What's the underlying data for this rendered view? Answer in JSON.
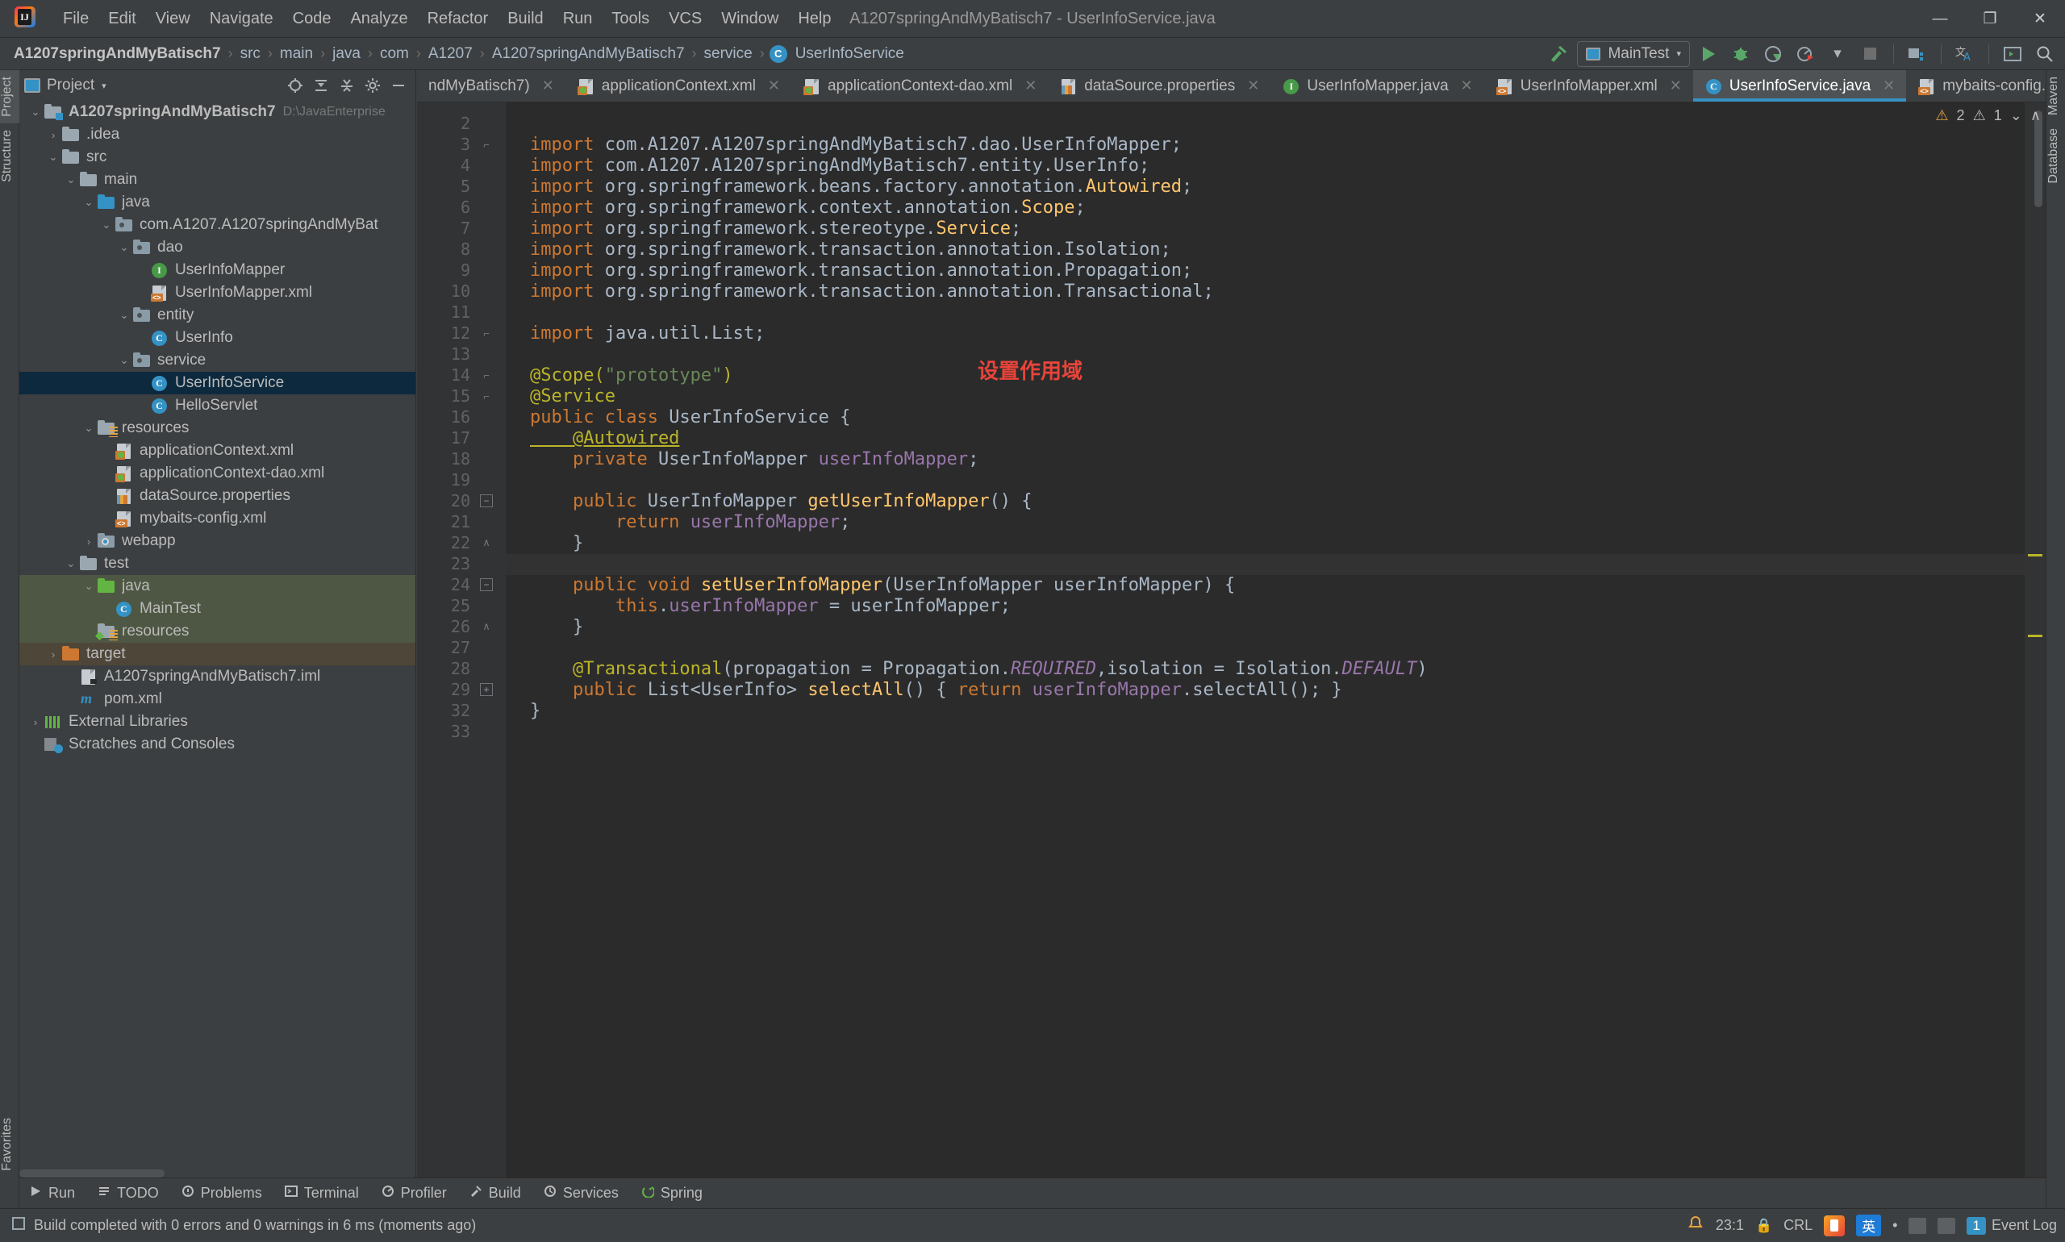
{
  "window": {
    "title": "A1207springAndMyBatisch7 - UserInfoService.java",
    "minimize": "—",
    "maximize": "❐",
    "close": "✕"
  },
  "menubar": {
    "items": [
      "File",
      "Edit",
      "View",
      "Navigate",
      "Code",
      "Analyze",
      "Refactor",
      "Build",
      "Run",
      "Tools",
      "VCS",
      "Window",
      "Help"
    ]
  },
  "breadcrumb": {
    "items": [
      "A1207springAndMyBatisch7",
      "src",
      "main",
      "java",
      "com",
      "A1207",
      "A1207springAndMyBatisch7",
      "service",
      "UserInfoService"
    ],
    "class_icon_letter": "C",
    "separator": "›"
  },
  "toolbar": {
    "run_config": "MainTest",
    "run_label": "Run",
    "debug_label": "Debug",
    "run_coverage_label": "Run with Coverage",
    "profiler_label": "Profile",
    "stop_label": "Stop",
    "build_label": "Build Project",
    "translate_label": "Translate",
    "terminal_label": "Terminal",
    "search_label": "Search Everywhere",
    "updates_label": "Update Project",
    "caret": "▾"
  },
  "left_strip": {
    "top": [
      "Project",
      "Structure"
    ],
    "bottom": [
      "Favorites"
    ]
  },
  "right_strip": {
    "top": [
      "Maven",
      "Database"
    ]
  },
  "project_panel": {
    "title": "Project",
    "caret": "▾",
    "actions": [
      "locate-icon",
      "expand-all-icon",
      "collapse-all-icon",
      "settings-icon",
      "hide-icon"
    ],
    "tree": [
      {
        "depth": 0,
        "arrow": "v",
        "label": "A1207springAndMyBatisch7",
        "sub": "D:\\JavaEnterprise",
        "icon": "folder-module",
        "bold": true,
        "state": "none"
      },
      {
        "depth": 1,
        "arrow": ">",
        "label": ".idea",
        "sub": "",
        "icon": "folder-gray",
        "bold": false,
        "state": "none"
      },
      {
        "depth": 1,
        "arrow": "v",
        "label": "src",
        "sub": "",
        "icon": "folder-gray",
        "bold": false,
        "state": "none"
      },
      {
        "depth": 2,
        "arrow": "v",
        "label": "main",
        "sub": "",
        "icon": "folder-gray",
        "bold": false,
        "state": "none"
      },
      {
        "depth": 3,
        "arrow": "v",
        "label": "java",
        "sub": "",
        "icon": "folder-blue",
        "bold": false,
        "state": "none"
      },
      {
        "depth": 4,
        "arrow": "v",
        "label": "com.A1207.A1207springAndMyBat",
        "sub": "",
        "icon": "package",
        "bold": false,
        "state": "none"
      },
      {
        "depth": 5,
        "arrow": "v",
        "label": "dao",
        "sub": "",
        "icon": "package",
        "bold": false,
        "state": "none"
      },
      {
        "depth": 6,
        "arrow": "",
        "label": "UserInfoMapper",
        "sub": "",
        "icon": "interface",
        "bold": false,
        "state": "none"
      },
      {
        "depth": 6,
        "arrow": "",
        "label": "UserInfoMapper.xml",
        "sub": "",
        "icon": "xml-file",
        "bold": false,
        "state": "none"
      },
      {
        "depth": 5,
        "arrow": "v",
        "label": "entity",
        "sub": "",
        "icon": "package",
        "bold": false,
        "state": "none"
      },
      {
        "depth": 6,
        "arrow": "",
        "label": "UserInfo",
        "sub": "",
        "icon": "class",
        "bold": false,
        "state": "none"
      },
      {
        "depth": 5,
        "arrow": "v",
        "label": "service",
        "sub": "",
        "icon": "package",
        "bold": false,
        "state": "none"
      },
      {
        "depth": 6,
        "arrow": "",
        "label": "UserInfoService",
        "sub": "",
        "icon": "class",
        "bold": false,
        "state": "selected"
      },
      {
        "depth": 6,
        "arrow": "",
        "label": "HelloServlet",
        "sub": "",
        "icon": "class",
        "bold": false,
        "state": "none"
      },
      {
        "depth": 3,
        "arrow": "v",
        "label": "resources",
        "sub": "",
        "icon": "folder-resources",
        "bold": false,
        "state": "none"
      },
      {
        "depth": 4,
        "arrow": "",
        "label": "applicationContext.xml",
        "sub": "",
        "icon": "spring-file",
        "bold": false,
        "state": "none"
      },
      {
        "depth": 4,
        "arrow": "",
        "label": "applicationContext-dao.xml",
        "sub": "",
        "icon": "spring-file",
        "bold": false,
        "state": "none"
      },
      {
        "depth": 4,
        "arrow": "",
        "label": "dataSource.properties",
        "sub": "",
        "icon": "properties-file",
        "bold": false,
        "state": "none"
      },
      {
        "depth": 4,
        "arrow": "",
        "label": "mybaits-config.xml",
        "sub": "",
        "icon": "xml-file",
        "bold": false,
        "state": "none"
      },
      {
        "depth": 3,
        "arrow": ">",
        "label": "webapp",
        "sub": "",
        "icon": "folder-web",
        "bold": false,
        "state": "none"
      },
      {
        "depth": 2,
        "arrow": "v",
        "label": "test",
        "sub": "",
        "icon": "folder-gray",
        "bold": false,
        "state": "none"
      },
      {
        "depth": 3,
        "arrow": "v",
        "label": "java",
        "sub": "",
        "icon": "folder-test",
        "bold": false,
        "state": "green"
      },
      {
        "depth": 4,
        "arrow": "",
        "label": "MainTest",
        "sub": "",
        "icon": "test-class",
        "bold": false,
        "state": "green"
      },
      {
        "depth": 3,
        "arrow": "",
        "label": "resources",
        "sub": "",
        "icon": "folder-test-resources",
        "bold": false,
        "state": "green"
      },
      {
        "depth": 1,
        "arrow": ">",
        "label": "target",
        "sub": "",
        "icon": "folder-excluded",
        "bold": false,
        "state": "brown"
      },
      {
        "depth": 2,
        "arrow": "",
        "label": "A1207springAndMyBatisch7.iml",
        "sub": "",
        "icon": "iml-file",
        "bold": false,
        "state": "none"
      },
      {
        "depth": 2,
        "arrow": "",
        "label": "pom.xml",
        "sub": "",
        "icon": "maven-file",
        "bold": false,
        "state": "none"
      },
      {
        "depth": 0,
        "arrow": ">",
        "label": "External Libraries",
        "sub": "",
        "icon": "libraries",
        "bold": false,
        "state": "none"
      },
      {
        "depth": 0,
        "arrow": "",
        "label": "Scratches and Consoles",
        "sub": "",
        "icon": "scratches",
        "bold": false,
        "state": "none"
      }
    ]
  },
  "editor": {
    "tabs": [
      {
        "label": "ndMyBatisch7)",
        "icon": "class",
        "active": false,
        "closable": true
      },
      {
        "label": "applicationContext.xml",
        "icon": "spring-file",
        "active": false,
        "closable": true
      },
      {
        "label": "applicationContext-dao.xml",
        "icon": "spring-file",
        "active": false,
        "closable": true
      },
      {
        "label": "dataSource.properties",
        "icon": "properties-file",
        "active": false,
        "closable": true
      },
      {
        "label": "UserInfoMapper.java",
        "icon": "interface",
        "active": false,
        "closable": true
      },
      {
        "label": "UserInfoMapper.xml",
        "icon": "xml-file",
        "active": false,
        "closable": true
      },
      {
        "label": "UserInfoService.java",
        "icon": "class",
        "active": true,
        "closable": true
      },
      {
        "label": "mybaits-config.xm",
        "icon": "xml-file",
        "active": false,
        "closable": false
      }
    ],
    "tab_overflow_caret": "⌄",
    "inspection": {
      "warnings_count": "2",
      "weak_warnings_count": "1",
      "warning_icon": "⚠",
      "weak_icon": "⚠",
      "chevron": "⌄"
    },
    "annotation_note": "设置作用域",
    "line_numbers": [
      "2",
      "3",
      "4",
      "5",
      "6",
      "7",
      "8",
      "9",
      "10",
      "11",
      "12",
      "13",
      "14",
      "15",
      "16",
      "17",
      "18",
      "19",
      "20",
      "21",
      "22",
      "23",
      "24",
      "25",
      "26",
      "27",
      "28",
      "29",
      "32",
      "33"
    ],
    "lines": [
      {
        "n": "2",
        "tokens": []
      },
      {
        "n": "3",
        "tokens": [
          {
            "t": "import ",
            "c": "kw"
          },
          {
            "t": "com.A1207.A1207springAndMyBatisch7.dao.UserInfoMapper;",
            "c": ""
          }
        ]
      },
      {
        "n": "4",
        "tokens": [
          {
            "t": "import ",
            "c": "kw"
          },
          {
            "t": "com.A1207.A1207springAndMyBatisch7.entity.UserInfo;",
            "c": ""
          }
        ]
      },
      {
        "n": "5",
        "tokens": [
          {
            "t": "import ",
            "c": "kw"
          },
          {
            "t": "org.springframework.beans.factory.annotation.",
            "c": ""
          },
          {
            "t": "Autowired",
            "c": "mth"
          },
          {
            "t": ";",
            "c": ""
          }
        ]
      },
      {
        "n": "6",
        "tokens": [
          {
            "t": "import ",
            "c": "kw"
          },
          {
            "t": "org.springframework.context.annotation.",
            "c": ""
          },
          {
            "t": "Scope",
            "c": "mth"
          },
          {
            "t": ";",
            "c": ""
          }
        ]
      },
      {
        "n": "7",
        "tokens": [
          {
            "t": "import ",
            "c": "kw"
          },
          {
            "t": "org.springframework.stereotype.",
            "c": ""
          },
          {
            "t": "Service",
            "c": "mth"
          },
          {
            "t": ";",
            "c": ""
          }
        ]
      },
      {
        "n": "8",
        "tokens": [
          {
            "t": "import ",
            "c": "kw"
          },
          {
            "t": "org.springframework.transaction.annotation.Isolation;",
            "c": ""
          }
        ]
      },
      {
        "n": "9",
        "tokens": [
          {
            "t": "import ",
            "c": "kw"
          },
          {
            "t": "org.springframework.transaction.annotation.Propagation;",
            "c": ""
          }
        ]
      },
      {
        "n": "10",
        "tokens": [
          {
            "t": "import ",
            "c": "kw"
          },
          {
            "t": "org.springframework.transaction.annotation.Transactional;",
            "c": ""
          }
        ]
      },
      {
        "n": "11",
        "tokens": []
      },
      {
        "n": "12",
        "tokens": [
          {
            "t": "import ",
            "c": "kw"
          },
          {
            "t": "java.util.List;",
            "c": ""
          }
        ]
      },
      {
        "n": "13",
        "tokens": []
      },
      {
        "n": "14",
        "tokens": [
          {
            "t": "@Scope(",
            "c": "ann"
          },
          {
            "t": "\"prototype\"",
            "c": "str"
          },
          {
            "t": ")",
            "c": "ann"
          }
        ]
      },
      {
        "n": "15",
        "tokens": [
          {
            "t": "@Service",
            "c": "ann"
          }
        ]
      },
      {
        "n": "16",
        "tokens": [
          {
            "t": "public ",
            "c": "kw"
          },
          {
            "t": "class ",
            "c": "kw"
          },
          {
            "t": "UserInfoService {",
            "c": ""
          }
        ]
      },
      {
        "n": "17",
        "tokens": [
          {
            "t": "    @Autowired",
            "c": "ann ul"
          }
        ]
      },
      {
        "n": "18",
        "tokens": [
          {
            "t": "    private ",
            "c": "kw"
          },
          {
            "t": "UserInfoMapper ",
            "c": ""
          },
          {
            "t": "userInfoMapper",
            "c": "fld"
          },
          {
            "t": ";",
            "c": ""
          }
        ]
      },
      {
        "n": "19",
        "tokens": []
      },
      {
        "n": "20",
        "tokens": [
          {
            "t": "    public ",
            "c": "kw"
          },
          {
            "t": "UserInfoMapper ",
            "c": ""
          },
          {
            "t": "getUserInfoMapper",
            "c": "mth"
          },
          {
            "t": "() {",
            "c": ""
          }
        ]
      },
      {
        "n": "21",
        "tokens": [
          {
            "t": "        return ",
            "c": "kw"
          },
          {
            "t": "userInfoMapper",
            "c": "fld"
          },
          {
            "t": ";",
            "c": ""
          }
        ]
      },
      {
        "n": "22",
        "tokens": [
          {
            "t": "    }",
            "c": ""
          }
        ]
      },
      {
        "n": "23",
        "tokens": []
      },
      {
        "n": "24",
        "tokens": [
          {
            "t": "    public ",
            "c": "kw"
          },
          {
            "t": "void ",
            "c": "kw"
          },
          {
            "t": "setUserInfoMapper",
            "c": "mth"
          },
          {
            "t": "(UserInfoMapper userInfoMapper) {",
            "c": ""
          }
        ]
      },
      {
        "n": "25",
        "tokens": [
          {
            "t": "        this",
            "c": "kw"
          },
          {
            "t": ".",
            "c": ""
          },
          {
            "t": "userInfoMapper",
            "c": "fld"
          },
          {
            "t": " = userInfoMapper;",
            "c": ""
          }
        ]
      },
      {
        "n": "26",
        "tokens": [
          {
            "t": "    }",
            "c": ""
          }
        ]
      },
      {
        "n": "27",
        "tokens": []
      },
      {
        "n": "28",
        "tokens": [
          {
            "t": "    @Transactional",
            "c": "ann"
          },
          {
            "t": "(propagation = Propagation.",
            "c": ""
          },
          {
            "t": "REQUIRED",
            "c": "st-fld"
          },
          {
            "t": ",isolation = Isolation.",
            "c": ""
          },
          {
            "t": "DEFAULT",
            "c": "st-fld"
          },
          {
            "t": ")",
            "c": ""
          }
        ]
      },
      {
        "n": "29",
        "tokens": [
          {
            "t": "    public ",
            "c": "kw"
          },
          {
            "t": "List<UserInfo> ",
            "c": ""
          },
          {
            "t": "selectAll",
            "c": "mth"
          },
          {
            "t": "() { ",
            "c": ""
          },
          {
            "t": "return ",
            "c": "kw"
          },
          {
            "t": "userInfoMapper",
            "c": "fld"
          },
          {
            "t": ".selectAll(); }",
            "c": ""
          }
        ]
      },
      {
        "n": "32",
        "tokens": [
          {
            "t": "}",
            "c": ""
          }
        ]
      },
      {
        "n": "33",
        "tokens": []
      }
    ]
  },
  "bottom_tools": [
    {
      "label": "Run",
      "icon": "play-icon"
    },
    {
      "label": "TODO",
      "icon": "todo-icon"
    },
    {
      "label": "Problems",
      "icon": "problems-icon"
    },
    {
      "label": "Terminal",
      "icon": "terminal-icon"
    },
    {
      "label": "Profiler",
      "icon": "profiler-icon"
    },
    {
      "label": "Build",
      "icon": "build-icon"
    },
    {
      "label": "Services",
      "icon": "services-icon"
    },
    {
      "label": "Spring",
      "icon": "spring-icon"
    }
  ],
  "statusbar": {
    "message": "Build completed with 0 errors and 0 warnings in 6 ms (moments ago)",
    "caret_position": "23:1",
    "line_separator": "CRL",
    "event_log": "Event Log",
    "event_log_count": "1",
    "ime_label": "英",
    "ime_dot": "•"
  },
  "colors": {
    "accent_blue": "#3592c4",
    "selection_blue": "#0d293e",
    "green": "#59a869",
    "orange": "#cc7832",
    "annotation_red": "#e8443a",
    "keyword": "#cc7832",
    "string": "#6a8759",
    "method": "#ffc66d",
    "field": "#9876aa",
    "annotation": "#bbb529",
    "editor_bg": "#2b2b2b",
    "panel_bg": "#3c3f41"
  }
}
